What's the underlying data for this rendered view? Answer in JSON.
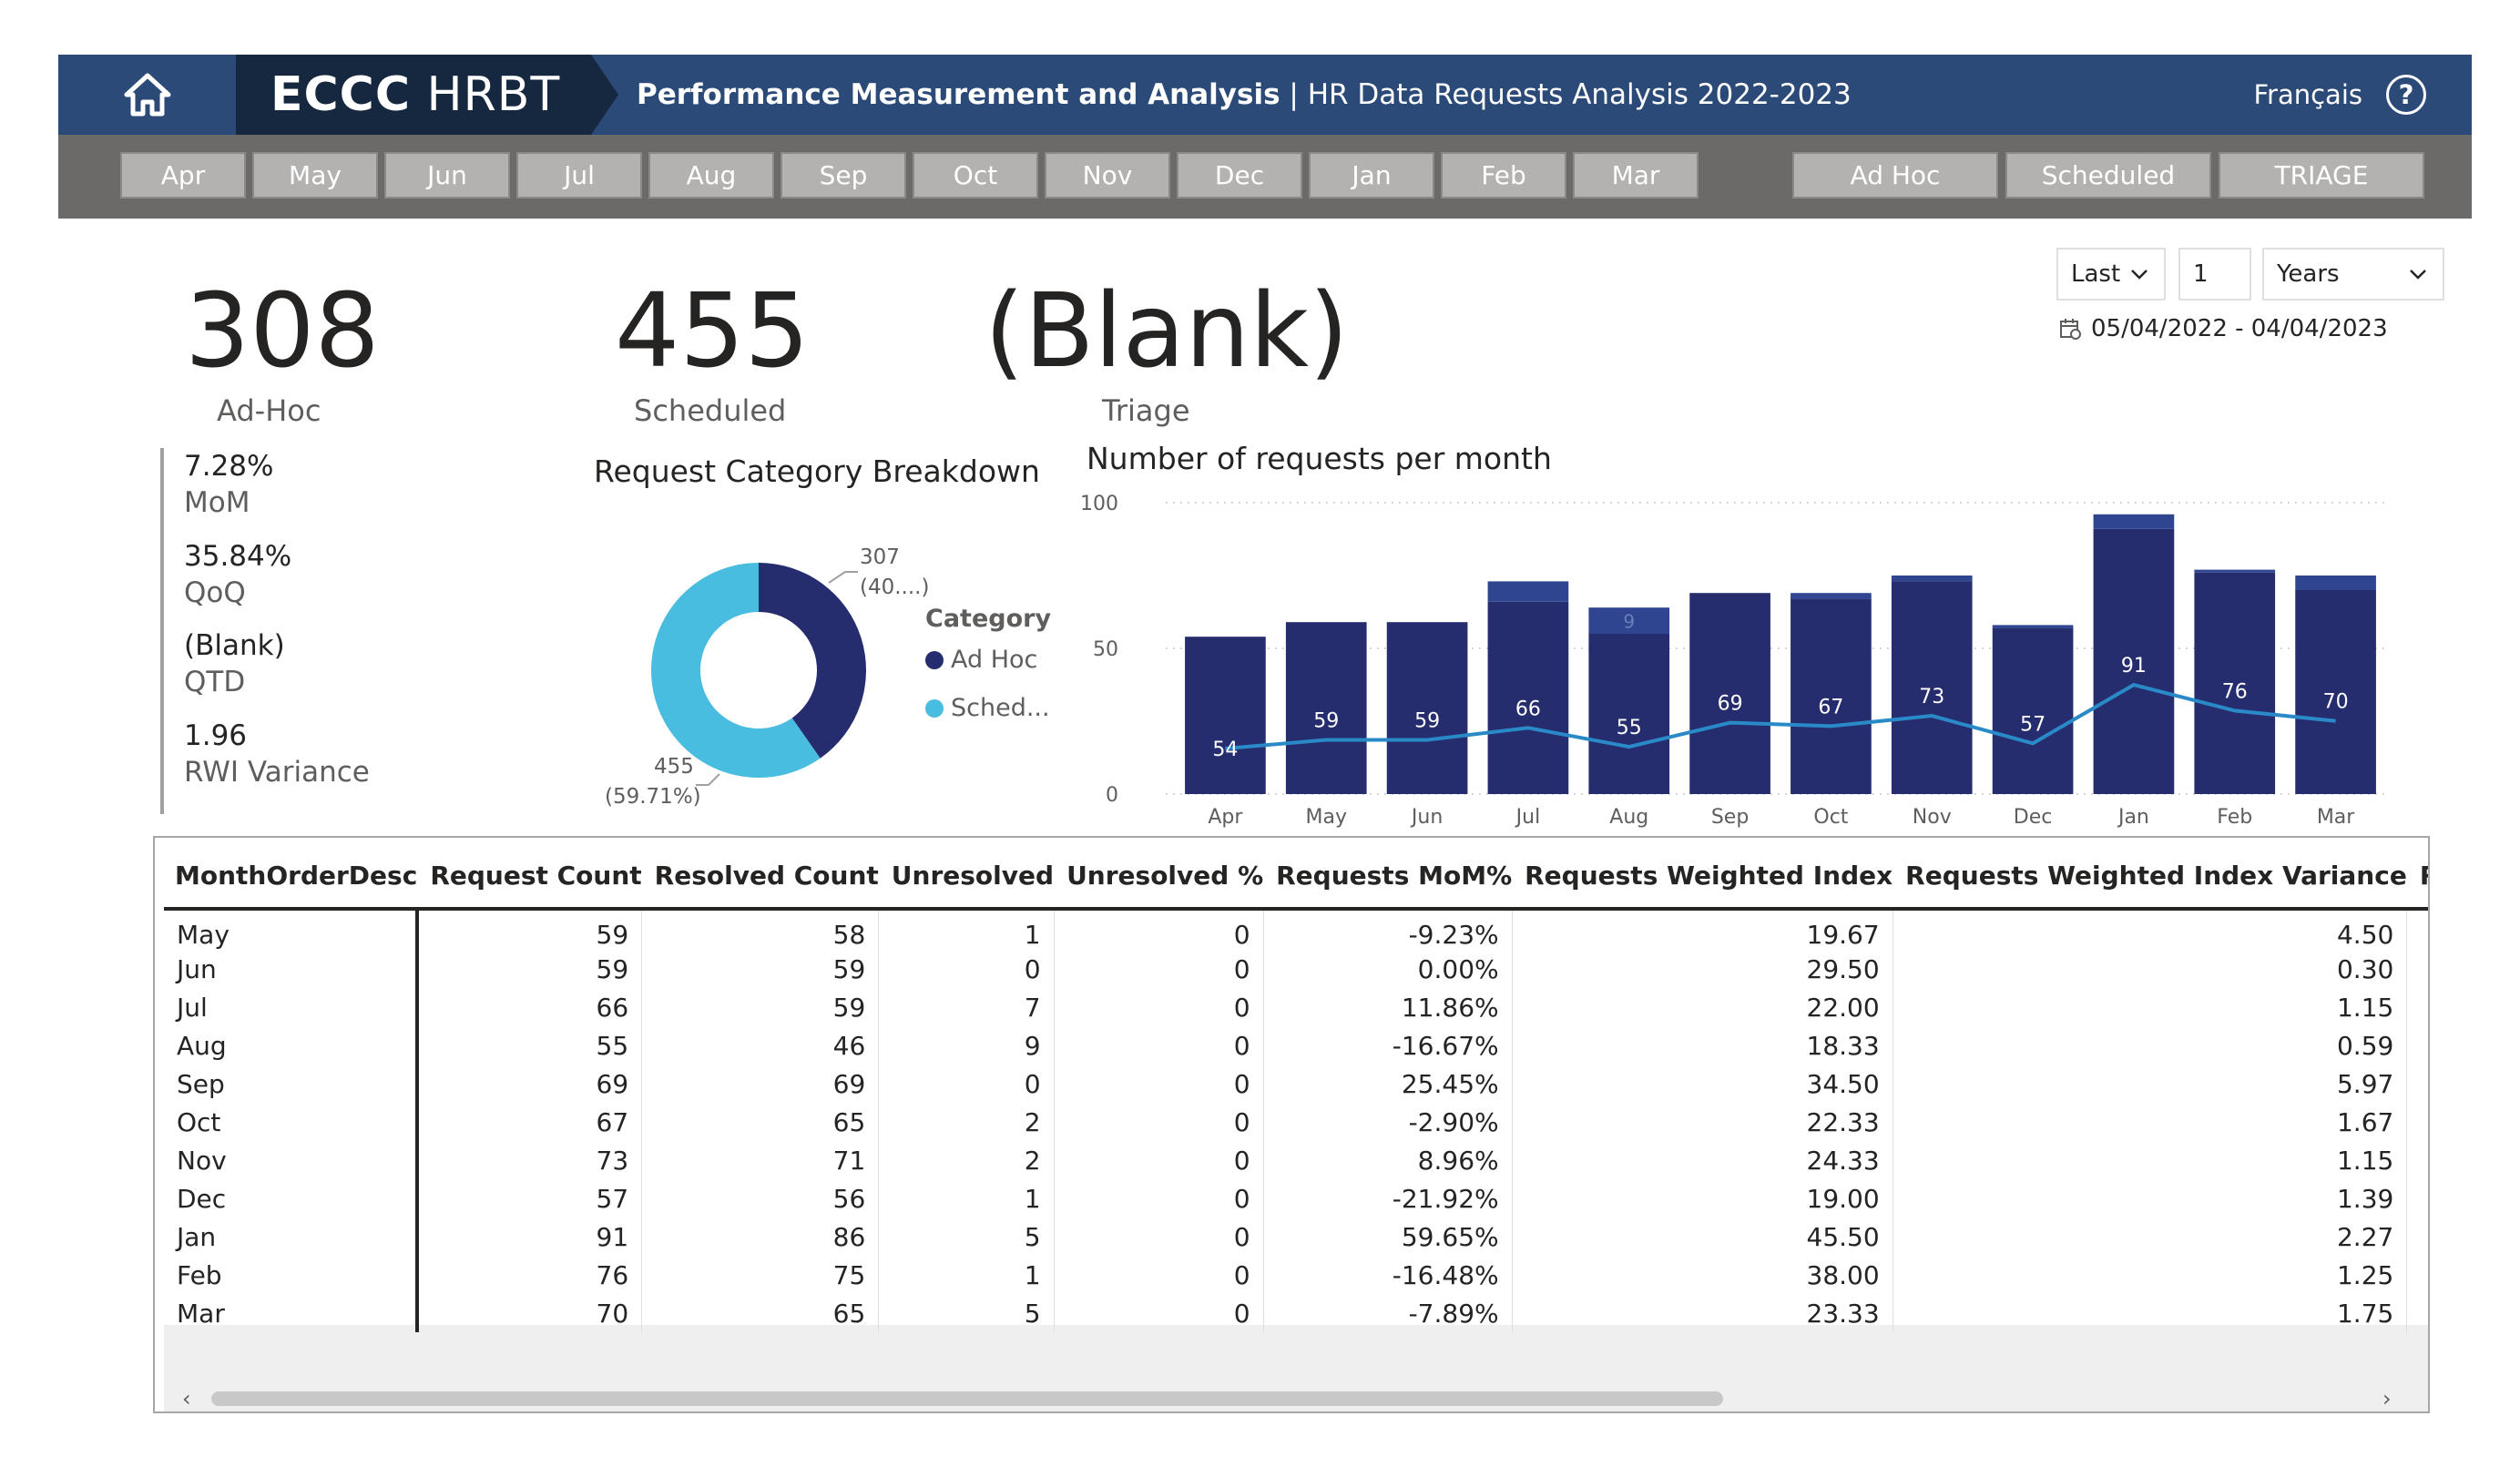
{
  "header": {
    "logo_bold": "ECCC",
    "logo_rest": " HRBT",
    "title_bold": "Performance Measurement and Analysis",
    "title_rest": " | HR Data Requests Analysis 2022-2023",
    "lang": "Français",
    "help": "?"
  },
  "months": [
    "Apr",
    "May",
    "Jun",
    "Jul",
    "Aug",
    "Sep",
    "Oct",
    "Nov",
    "Dec",
    "Jan",
    "Feb",
    "Mar"
  ],
  "types": [
    "Ad Hoc",
    "Scheduled",
    "TRIAGE"
  ],
  "kpis": {
    "adhoc": {
      "value": "308",
      "label": "Ad-Hoc"
    },
    "scheduled": {
      "value": "455",
      "label": "Scheduled"
    },
    "triage": {
      "value": "(Blank)",
      "label": "Triage"
    }
  },
  "side_metrics": [
    {
      "value": "7.28%",
      "label": "MoM"
    },
    {
      "value": "35.84%",
      "label": "QoQ"
    },
    {
      "value": "(Blank)",
      "label": "QTD"
    },
    {
      "value": "1.96",
      "label": "RWI Variance"
    }
  ],
  "filter": {
    "mode": "Last",
    "count": "1",
    "unit": "Years",
    "date_range": "05/04/2022 - 04/04/2023"
  },
  "donut": {
    "title": "Request Category Breakdown",
    "label_adhoc_value": "307",
    "label_adhoc_pct": "(40....)",
    "label_sched_value": "455",
    "label_sched_pct": "(59.71%)",
    "legend_title": "Category",
    "legend_items": [
      "Ad Hoc",
      "Sched..."
    ],
    "colors": {
      "adhoc": "#252d6e",
      "sched": "#48bde0"
    }
  },
  "bar_chart": {
    "title": "Number of requests per month"
  },
  "chart_data": [
    {
      "type": "pie",
      "title": "Request Category Breakdown",
      "categories": [
        "Ad Hoc",
        "Scheduled"
      ],
      "values": [
        307,
        455
      ],
      "donut": true
    },
    {
      "type": "bar",
      "title": "Number of requests per month",
      "categories": [
        "Apr",
        "May",
        "Jun",
        "Jul",
        "Aug",
        "Sep",
        "Oct",
        "Nov",
        "Dec",
        "Jan",
        "Feb",
        "Mar"
      ],
      "ylim": [
        0,
        100
      ],
      "yticks": [
        0,
        50,
        100
      ],
      "series": [
        {
          "values": [
            54,
            59,
            59,
            66,
            55,
            69,
            67,
            73,
            57,
            91,
            76,
            70
          ],
          "color": "#252d6e"
        },
        {
          "values": [
            0,
            0,
            0,
            7,
            9,
            0,
            2,
            2,
            1,
            5,
            1,
            5
          ],
          "color": "#2f4590",
          "label_shown": [
            false,
            false,
            false,
            false,
            true,
            false,
            false,
            false,
            false,
            false,
            false,
            false
          ]
        }
      ],
      "line": {
        "values": [
          54,
          59,
          59,
          66,
          55,
          69,
          67,
          73,
          57,
          91,
          76,
          70
        ],
        "color": "#2a8ac8"
      },
      "stack_label": [
        "",
        "",
        "",
        "",
        "9",
        "",
        "",
        "",
        "",
        "",
        "",
        ""
      ]
    }
  ],
  "table": {
    "columns": [
      "MonthOrderDesc",
      "Request Count",
      "Resolved Count",
      "Unresolved",
      "Unresolved %",
      "Requests MoM%",
      "Requests Weighted Index",
      "Requests Weighted Index Variance",
      "Requests Weighted Inde:"
    ],
    "rows": [
      [
        "May",
        "59",
        "58",
        "1",
        "0",
        "-9.23%",
        "19.67",
        "4.50",
        ""
      ],
      [
        "Jun",
        "59",
        "59",
        "0",
        "0",
        "0.00%",
        "29.50",
        "0.30",
        ""
      ],
      [
        "Jul",
        "66",
        "59",
        "7",
        "0",
        "11.86%",
        "22.00",
        "1.15",
        ""
      ],
      [
        "Aug",
        "55",
        "46",
        "9",
        "0",
        "-16.67%",
        "18.33",
        "0.59",
        ""
      ],
      [
        "Sep",
        "69",
        "69",
        "0",
        "0",
        "25.45%",
        "34.50",
        "5.97",
        ""
      ],
      [
        "Oct",
        "67",
        "65",
        "2",
        "0",
        "-2.90%",
        "22.33",
        "1.67",
        ""
      ],
      [
        "Nov",
        "73",
        "71",
        "2",
        "0",
        "8.96%",
        "24.33",
        "1.15",
        ""
      ],
      [
        "Dec",
        "57",
        "56",
        "1",
        "0",
        "-21.92%",
        "19.00",
        "1.39",
        ""
      ],
      [
        "Jan",
        "91",
        "86",
        "5",
        "0",
        "59.65%",
        "45.50",
        "2.27",
        ""
      ],
      [
        "Feb",
        "76",
        "75",
        "1",
        "0",
        "-16.48%",
        "38.00",
        "1.25",
        ""
      ],
      [
        "Mar",
        "70",
        "65",
        "5",
        "0",
        "-7.89%",
        "23.33",
        "1.75",
        ""
      ]
    ]
  }
}
